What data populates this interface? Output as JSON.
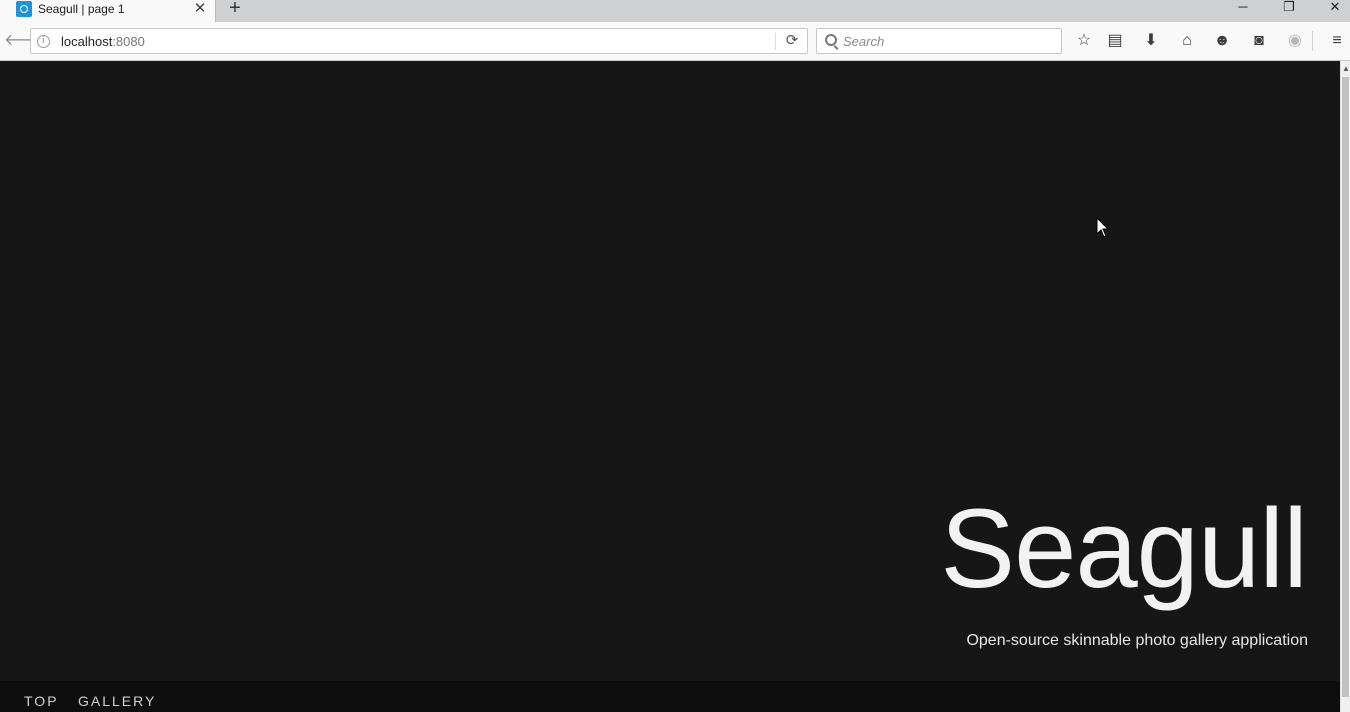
{
  "browser": {
    "tab": {
      "title": "Seagull | page 1"
    },
    "url": {
      "host": "localhost",
      "port": ":8080"
    },
    "search": {
      "placeholder": "Search"
    }
  },
  "page": {
    "title": "Seagull",
    "subtitle": "Open-source skinnable photo gallery application",
    "nav": [
      "TOP",
      "GALLERY"
    ]
  }
}
